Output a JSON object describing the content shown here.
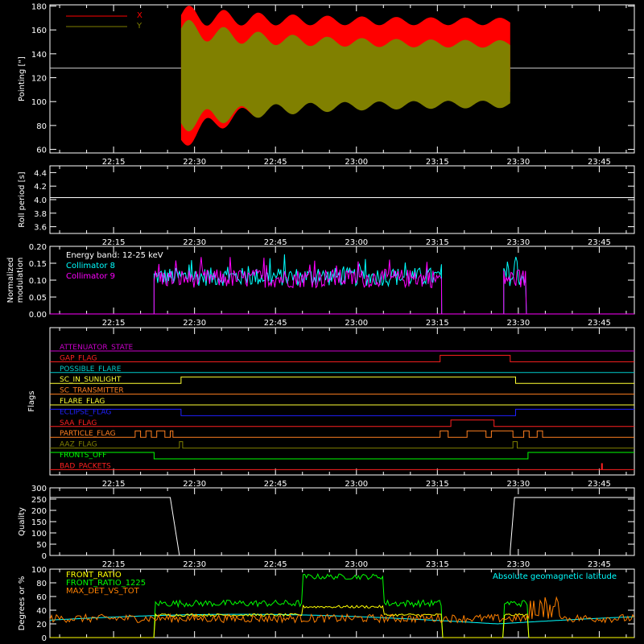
{
  "chart_data": [
    {
      "type": "line",
      "ylabel": "Pointing [\"]",
      "ylim": [
        57,
        181
      ],
      "yticks": [
        60,
        80,
        100,
        120,
        140,
        160,
        180
      ],
      "xticks": [
        "22:15",
        "22:30",
        "22:45",
        "23:00",
        "23:15",
        "23:30",
        "23:45"
      ],
      "legend": [
        "X",
        "Y"
      ],
      "reference_line": 128,
      "series": [
        {
          "name": "X",
          "color": "#ff0000",
          "envelope_start": [
            68,
            176
          ],
          "envelope_end": [
            108,
            167
          ]
        },
        {
          "name": "Y",
          "color": "#808000",
          "envelope_start": [
            82,
            170
          ],
          "envelope_end": [
            98,
            148
          ]
        }
      ]
    },
    {
      "type": "line",
      "ylabel": "Roll period [s]",
      "ylim": [
        3.5,
        4.5
      ],
      "yticks": [
        3.6,
        3.8,
        4.0,
        4.2,
        4.4
      ],
      "xticks": [
        "22:15",
        "22:30",
        "22:45",
        "23:00",
        "23:15",
        "23:30",
        "23:45"
      ],
      "constant_value": 4.03
    },
    {
      "type": "line",
      "ylabel_lines": [
        "Normalized",
        "modulation"
      ],
      "ylim": [
        0,
        0.2
      ],
      "yticks": [
        "0.00",
        "0.05",
        "0.10",
        "0.15",
        "0.20"
      ],
      "xticks": [
        "22:15",
        "22:30",
        "22:45",
        "23:00",
        "23:15",
        "23:30",
        "23:45"
      ],
      "annotation": "Energy band: 12-25 keV",
      "series": [
        {
          "name": "Collimator 8",
          "color": "#00ffff",
          "mean": 0.11
        },
        {
          "name": "Collimator 9",
          "color": "#ff00ff",
          "mean": 0.105
        }
      ]
    },
    {
      "type": "line",
      "ylabel": "Flags",
      "xticks": [
        "22:15",
        "22:30",
        "22:45",
        "23:00",
        "23:15",
        "23:30",
        "23:45"
      ],
      "flags": [
        {
          "name": "ATTENUATOR_STATE",
          "color": "#cc00cc"
        },
        {
          "name": "GAP_FLAG",
          "color": "#ff2020"
        },
        {
          "name": "POSSIBLE_FLARE",
          "color": "#00cccc"
        },
        {
          "name": "SC_IN_SUNLIGHT",
          "color": "#ffff33"
        },
        {
          "name": "SC_TRANSMITTER",
          "color": "#ff7f20"
        },
        {
          "name": "FLARE_FLAG",
          "color": "#ffff33"
        },
        {
          "name": "ECLIPSE_FLAG",
          "color": "#2020ff"
        },
        {
          "name": "SAA_FLAG",
          "color": "#ff2020"
        },
        {
          "name": "PARTICLE_FLAG",
          "color": "#ff7f20"
        },
        {
          "name": "AAZ_FLAG",
          "color": "#808000"
        },
        {
          "name": "FRONTS_OFF",
          "color": "#00ff00"
        },
        {
          "name": "BAD_PACKETS",
          "color": "#ff2020"
        }
      ]
    },
    {
      "type": "line",
      "ylabel": "Quality",
      "ylim": [
        0,
        300
      ],
      "yticks": [
        0,
        50,
        100,
        150,
        200,
        250,
        300
      ],
      "xticks": [
        "22:15",
        "22:30",
        "22:45",
        "23:00",
        "23:15",
        "23:30",
        "23:45"
      ],
      "levels": [
        257,
        0,
        257
      ]
    },
    {
      "type": "line",
      "ylabel": "Degrees or %",
      "ylim": [
        0,
        100
      ],
      "yticks": [
        0,
        20,
        40,
        60,
        80,
        100
      ],
      "legend_right": "Absolute geomagnetic latitude",
      "series": [
        {
          "name": "FRONT_RATIO",
          "color": "#ffff00"
        },
        {
          "name": "FRONT_RATIO_1225",
          "color": "#00ff00"
        },
        {
          "name": "MAX_DET_VS_TOT",
          "color": "#ff8000"
        },
        {
          "name": "Absolute geomagnetic latitude",
          "color": "#00ffff"
        }
      ]
    }
  ]
}
